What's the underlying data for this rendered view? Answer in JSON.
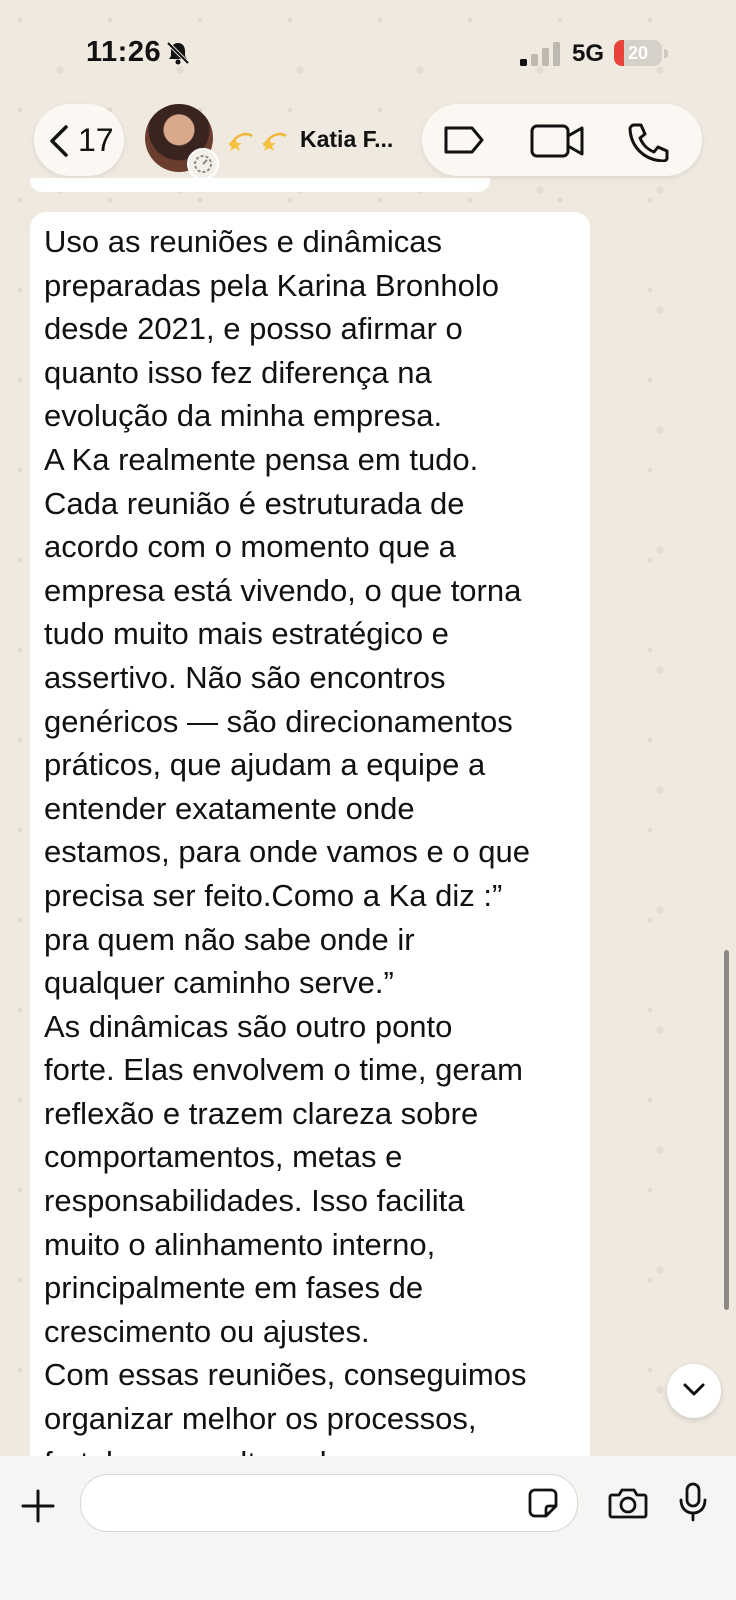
{
  "status_bar": {
    "time": "11:26",
    "network": "5G",
    "battery_level": "20",
    "battery_fraction": 0.2,
    "battery_color": "#e8423b",
    "icons": [
      "bell-slash-icon",
      "signal-icon",
      "battery-icon"
    ]
  },
  "header": {
    "back_count": "17",
    "contact_name": "Katia F...",
    "name_prefix_emoji": [
      "dizzy-star-icon",
      "dizzy-star-icon"
    ],
    "actions": [
      "label-icon",
      "video-call-icon",
      "voice-call-icon"
    ]
  },
  "message": {
    "text": "Uso as reuniões e dinâmicas\npreparadas pela Karina Bronholo\ndesde 2021, e posso afirmar o\nquanto isso fez diferença na\nevolução da minha empresa.\nA Ka realmente pensa em tudo.\nCada reunião é estruturada de\nacordo com o momento que a\nempresa está vivendo, o que torna\ntudo muito mais estratégico e\nassertivo. Não são encontros\ngenéricos — são direcionamentos\npráticos, que ajudam a equipe a\nentender exatamente onde\nestamos, para onde vamos e o que\nprecisa ser feito.Como a Ka diz :”\npra quem não sabe onde ir\nqualquer caminho serve.”\nAs dinâmicas são outro ponto\nforte. Elas envolvem o time, geram\nreflexão e trazem clareza sobre\ncomportamentos, metas e\nresponsabilidades. Isso facilita\nmuito o alinhamento interno,\nprincipalmente em fases de\ncrescimento ou ajustes.\nCom essas reuniões, conseguimos\norganizar melhor os processos,\nfortalecer a cultura da empresa e"
  },
  "composer": {
    "input_value": "",
    "icons": [
      "plus-icon",
      "sticker-icon",
      "camera-icon",
      "microphone-icon"
    ]
  }
}
